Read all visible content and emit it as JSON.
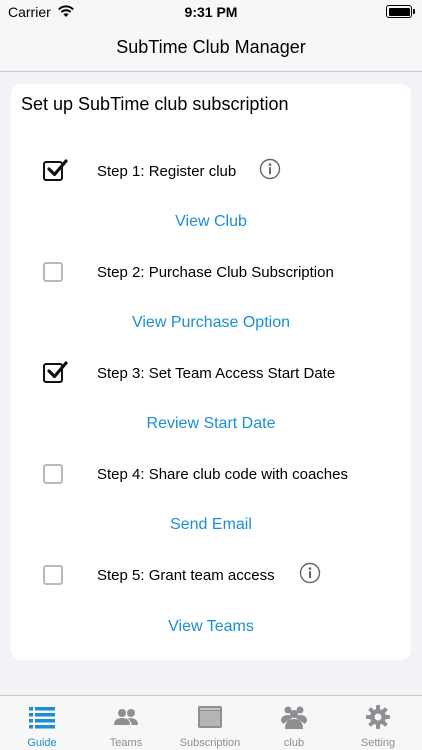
{
  "status_bar": {
    "carrier": "Carrier",
    "time": "9:31 PM"
  },
  "nav": {
    "title": "SubTime Club Manager"
  },
  "card": {
    "title": "Set up SubTime club subscription",
    "steps": [
      {
        "label": "Step 1:  Register club",
        "checked": true,
        "info": true,
        "action": "View Club"
      },
      {
        "label": "Step 2: Purchase Club Subscription",
        "checked": false,
        "info": false,
        "action": "View Purchase Option"
      },
      {
        "label": "Step 3: Set Team Access Start Date",
        "checked": true,
        "info": false,
        "action": "Review Start Date"
      },
      {
        "label": "Step 4: Share club code with coaches",
        "checked": false,
        "info": false,
        "action": "Send Email"
      },
      {
        "label": "Step 5: Grant team access",
        "checked": false,
        "info": true,
        "action": "View Teams"
      }
    ]
  },
  "tabs": [
    {
      "label": "Guide",
      "icon": "list-icon",
      "active": true
    },
    {
      "label": "Teams",
      "icon": "people-icon",
      "active": false
    },
    {
      "label": "Subscription",
      "icon": "subscription-icon",
      "active": false
    },
    {
      "label": "club",
      "icon": "group-icon",
      "active": false
    },
    {
      "label": "Setting",
      "icon": "gear-icon",
      "active": false
    }
  ],
  "colors": {
    "accent": "#1b8fd1",
    "inactive": "#8e8e93",
    "background": "#f2f2f7"
  }
}
